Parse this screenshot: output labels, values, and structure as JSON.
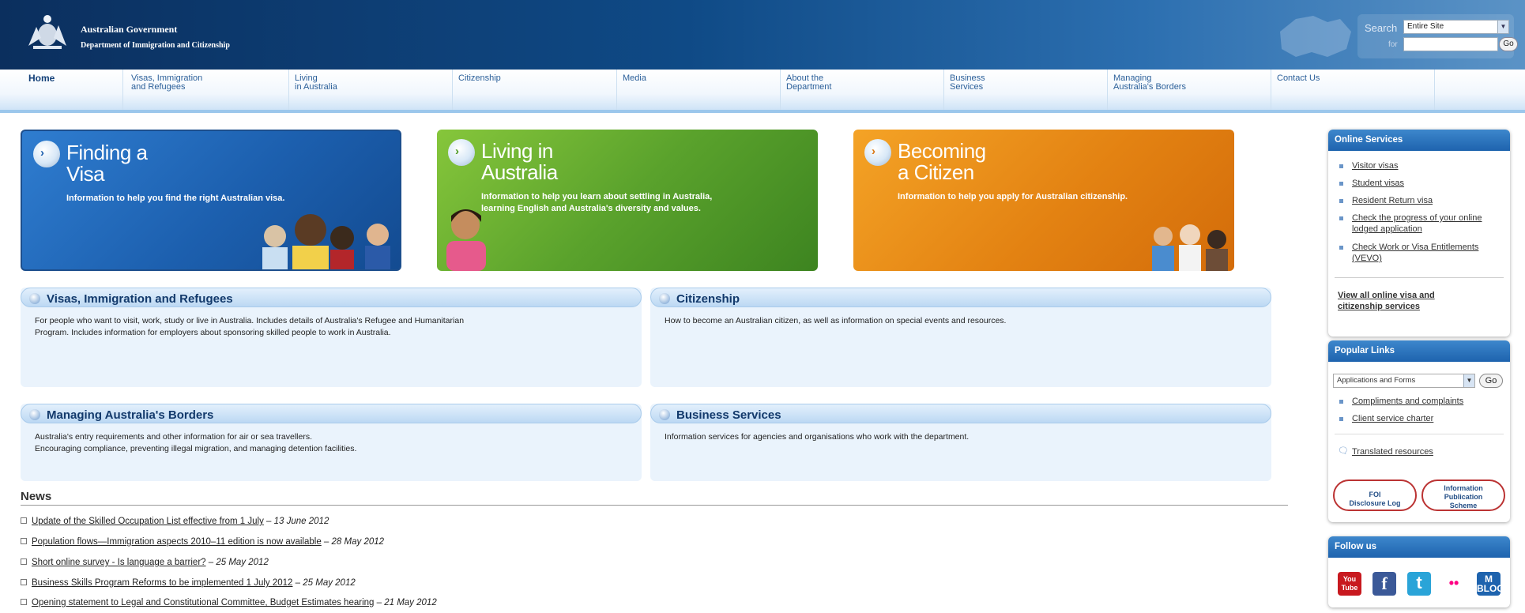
{
  "header": {
    "gov_name": "Australian Government",
    "dept_name": "Department of Immigration and Citizenship",
    "search": {
      "label": "Search",
      "scope": "Entire Site",
      "for_label": "for",
      "query": "",
      "go_label": "Go"
    }
  },
  "nav": {
    "items": [
      {
        "label": "Home"
      },
      {
        "label": "Visas, Immigration\nand Refugees"
      },
      {
        "label": "Living\nin Australia"
      },
      {
        "label": "Citizenship"
      },
      {
        "label": "Media"
      },
      {
        "label": "About the\nDepartment"
      },
      {
        "label": "Business\nServices"
      },
      {
        "label": "Managing\nAustralia's Borders"
      },
      {
        "label": "Contact Us"
      }
    ]
  },
  "features": [
    {
      "title": "Finding a\nVisa",
      "description": "Information to help you find the right Australian visa."
    },
    {
      "title": "Living in\nAustralia",
      "description": "Information to help you learn about settling in Australia,\nlearning English and Australia's diversity and values."
    },
    {
      "title": "Becoming\na Citizen",
      "description": "Information to help you apply for Australian citizenship."
    }
  ],
  "sections": [
    {
      "title": "Visas, Immigration and Refugees",
      "body": "For people who want to visit, work, study or live in Australia. Includes details of Australia's Refugee and Humanitarian\nProgram. Includes information for employers about sponsoring skilled people to work in Australia."
    },
    {
      "title": "Citizenship",
      "body": "How to become an Australian citizen, as well as information on special events and resources."
    },
    {
      "title": "Managing Australia's Borders",
      "body": "Australia's entry requirements and other information for air or sea travellers.\nEncouraging compliance, preventing illegal migration, and managing detention facilities."
    },
    {
      "title": "Business Services",
      "body": "Information services for agencies and organisations who work with the department."
    }
  ],
  "news": {
    "title": "News",
    "items": [
      {
        "text": "Update of the Skilled Occupation List effective from 1 July",
        "date": "13 June 2012"
      },
      {
        "text": "Population flows—Immigration aspects 2010–11 edition is now available",
        "date": "28 May 2012"
      },
      {
        "text": "Short online survey - Is language a barrier?",
        "date": "25 May 2012"
      },
      {
        "text": "Business Skills Program Reforms to be implemented 1 July 2012",
        "date": "25 May 2012"
      },
      {
        "text": "Opening statement to Legal and Constitutional Committee, Budget Estimates hearing",
        "date": "21 May 2012"
      }
    ]
  },
  "sidebar": {
    "online": {
      "title": "Online Services",
      "links": [
        {
          "label": "Visitor visas"
        },
        {
          "label": "Student visas"
        },
        {
          "label": "Resident Return visa"
        },
        {
          "label": "Check the progress of your online\nlodged application"
        },
        {
          "label": "Check Work or Visa Entitlements\n(VEVO)"
        }
      ],
      "view_all": "View all online visa and\ncitizenship services"
    },
    "popular": {
      "title": "Popular Links",
      "select_value": "Applications and Forms",
      "go_label": "Go",
      "links": [
        {
          "label": "Compliments and complaints"
        },
        {
          "label": "Client service charter"
        }
      ],
      "translated": "Translated resources",
      "badge_foi": "FOI\nDisclosure Log",
      "badge_ips": "Information\nPublication\nScheme"
    },
    "follow": {
      "title": "Follow us",
      "youtube": "You\nTube",
      "facebook": "f",
      "twitter": "t",
      "flickr": "••",
      "blog": "M\nBLOG"
    }
  },
  "colors": {
    "header_dark": "#0b2f5e",
    "nav_text": "#2b5f99",
    "visa_blue": "#1c5fae",
    "living_green": "#5aa22c",
    "citizen_orange": "#e38212",
    "sidebar_head": "#1e63ae"
  }
}
